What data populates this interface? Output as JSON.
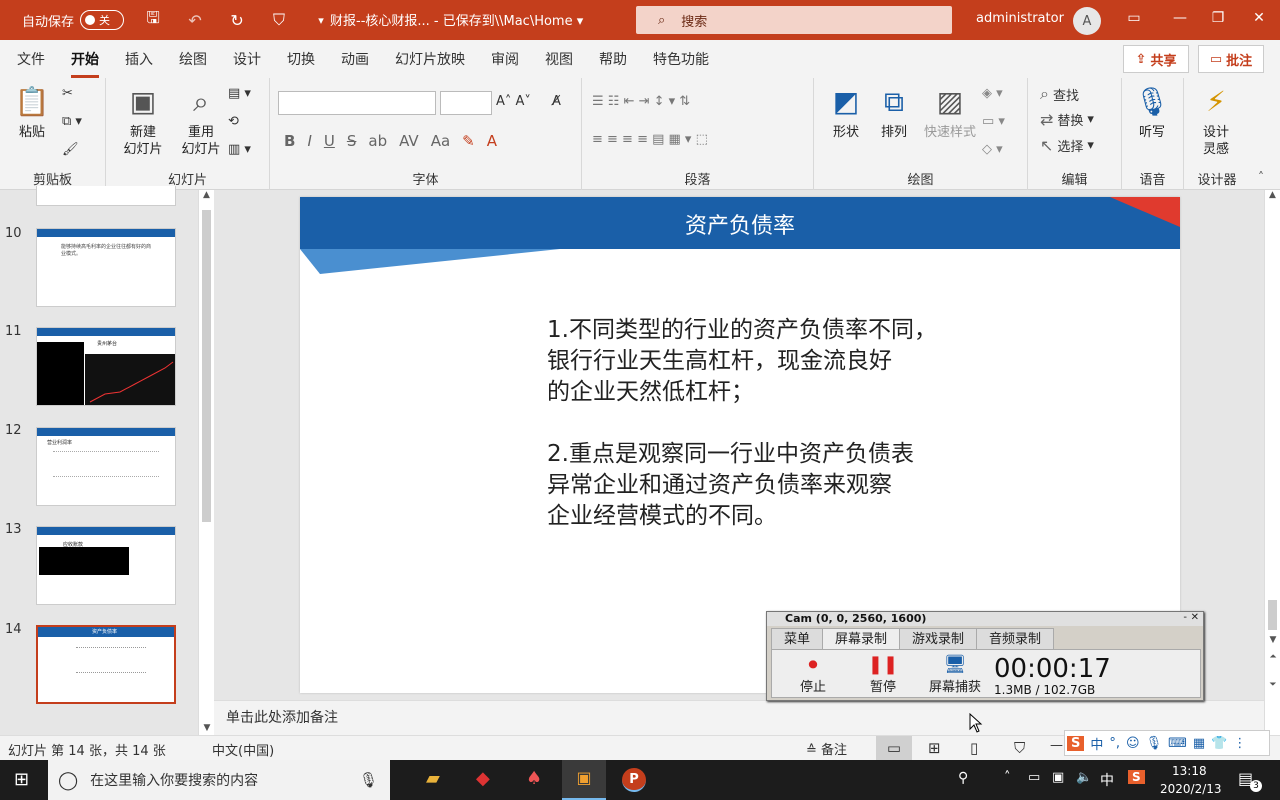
{
  "titlebar": {
    "autosave_label": "自动保存",
    "autosave_state": "关",
    "doc_title": "财报--核心财报... - 已保存到\\\\Mac\\Home ▾",
    "search_placeholder": "搜索",
    "user": "administrator",
    "avatar_initial": "A"
  },
  "menu": {
    "tabs": [
      "文件",
      "开始",
      "插入",
      "绘图",
      "设计",
      "切换",
      "动画",
      "幻灯片放映",
      "审阅",
      "视图",
      "帮助",
      "特色功能"
    ],
    "active": "开始",
    "share": "共享",
    "comments": "批注"
  },
  "ribbon": {
    "clipboard": {
      "label": "剪贴板",
      "paste": "粘贴"
    },
    "slides": {
      "label": "幻灯片",
      "new_slide": "新建\n幻灯片",
      "reuse_slide": "重用\n幻灯片"
    },
    "font": {
      "label": "字体"
    },
    "paragraph": {
      "label": "段落"
    },
    "drawing": {
      "label": "绘图",
      "shape": "形状",
      "arrange": "排列",
      "quick_styles": "快速样式"
    },
    "editing": {
      "label": "编辑",
      "find": "查找",
      "replace": "替换",
      "select": "选择"
    },
    "voice": {
      "label": "语音",
      "dictate": "听写"
    },
    "designer": {
      "label": "设计器",
      "design_ideas": "设计\n灵感"
    }
  },
  "thumbnails": [
    {
      "num": "10",
      "text": "能够持续高毛利率的企业往往都有好的商业模式。"
    },
    {
      "num": "11",
      "text": "贵州茅台"
    },
    {
      "num": "12",
      "text": "营业利润率"
    },
    {
      "num": "13",
      "text": "应收账款"
    },
    {
      "num": "14",
      "text": "资产负债率",
      "selected": true
    }
  ],
  "slide": {
    "title": "资产负债率",
    "para1": [
      "1.不同类型的行业的资产负债率不同，",
      "银行行业天生高杠杆，现金流良好",
      "的企业天然低杠杆；"
    ],
    "para2": [
      "2.重点是观察同一行业中资产负债表",
      "异常企业和通过资产负债率来观察",
      "企业经营模式的不同。"
    ]
  },
  "notes_placeholder": "单击此处添加备注",
  "status": {
    "slide_info": "幻灯片 第 14 张，共 14 张",
    "language": "中文(中国)",
    "notes_btn": "备注"
  },
  "cam": {
    "title": "Cam (0, 0, 2560, 1600)",
    "tabs": [
      "菜单",
      "屏幕录制",
      "游戏录制",
      "音频录制"
    ],
    "active_tab": "屏幕录制",
    "stop": "停止",
    "pause": "暂停",
    "capture": "屏幕捕获",
    "timer": "00:00:17",
    "size": "1.3MB / 102.7GB"
  },
  "taskbar": {
    "search_placeholder": "在这里输入你要搜索的内容",
    "ime": "中",
    "time": "13:18",
    "date": "2020/2/13",
    "notif_count": "3"
  },
  "colors": {
    "accent": "#c43e1c",
    "slide_blue": "#1a5fa8"
  }
}
